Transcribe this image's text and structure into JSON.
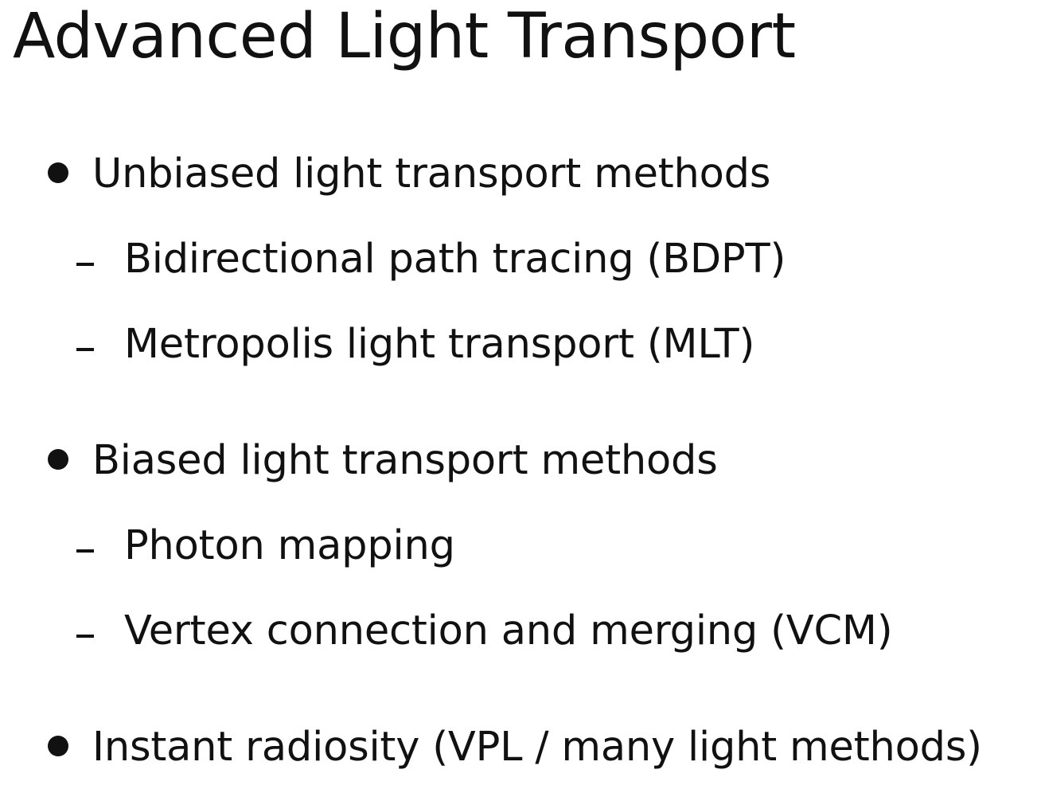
{
  "slide": {
    "title": "Advanced Light Transport",
    "groups": [
      {
        "label": "Unbiased light transport methods",
        "items": [
          "Bidirectional path tracing (BDPT)",
          "Metropolis light transport (MLT)"
        ]
      },
      {
        "label": "Biased light transport methods",
        "items": [
          "Photon mapping",
          "Vertex connection and merging (VCM)"
        ]
      },
      {
        "label": "Instant radiosity (VPL / many light methods)",
        "items": []
      }
    ]
  }
}
